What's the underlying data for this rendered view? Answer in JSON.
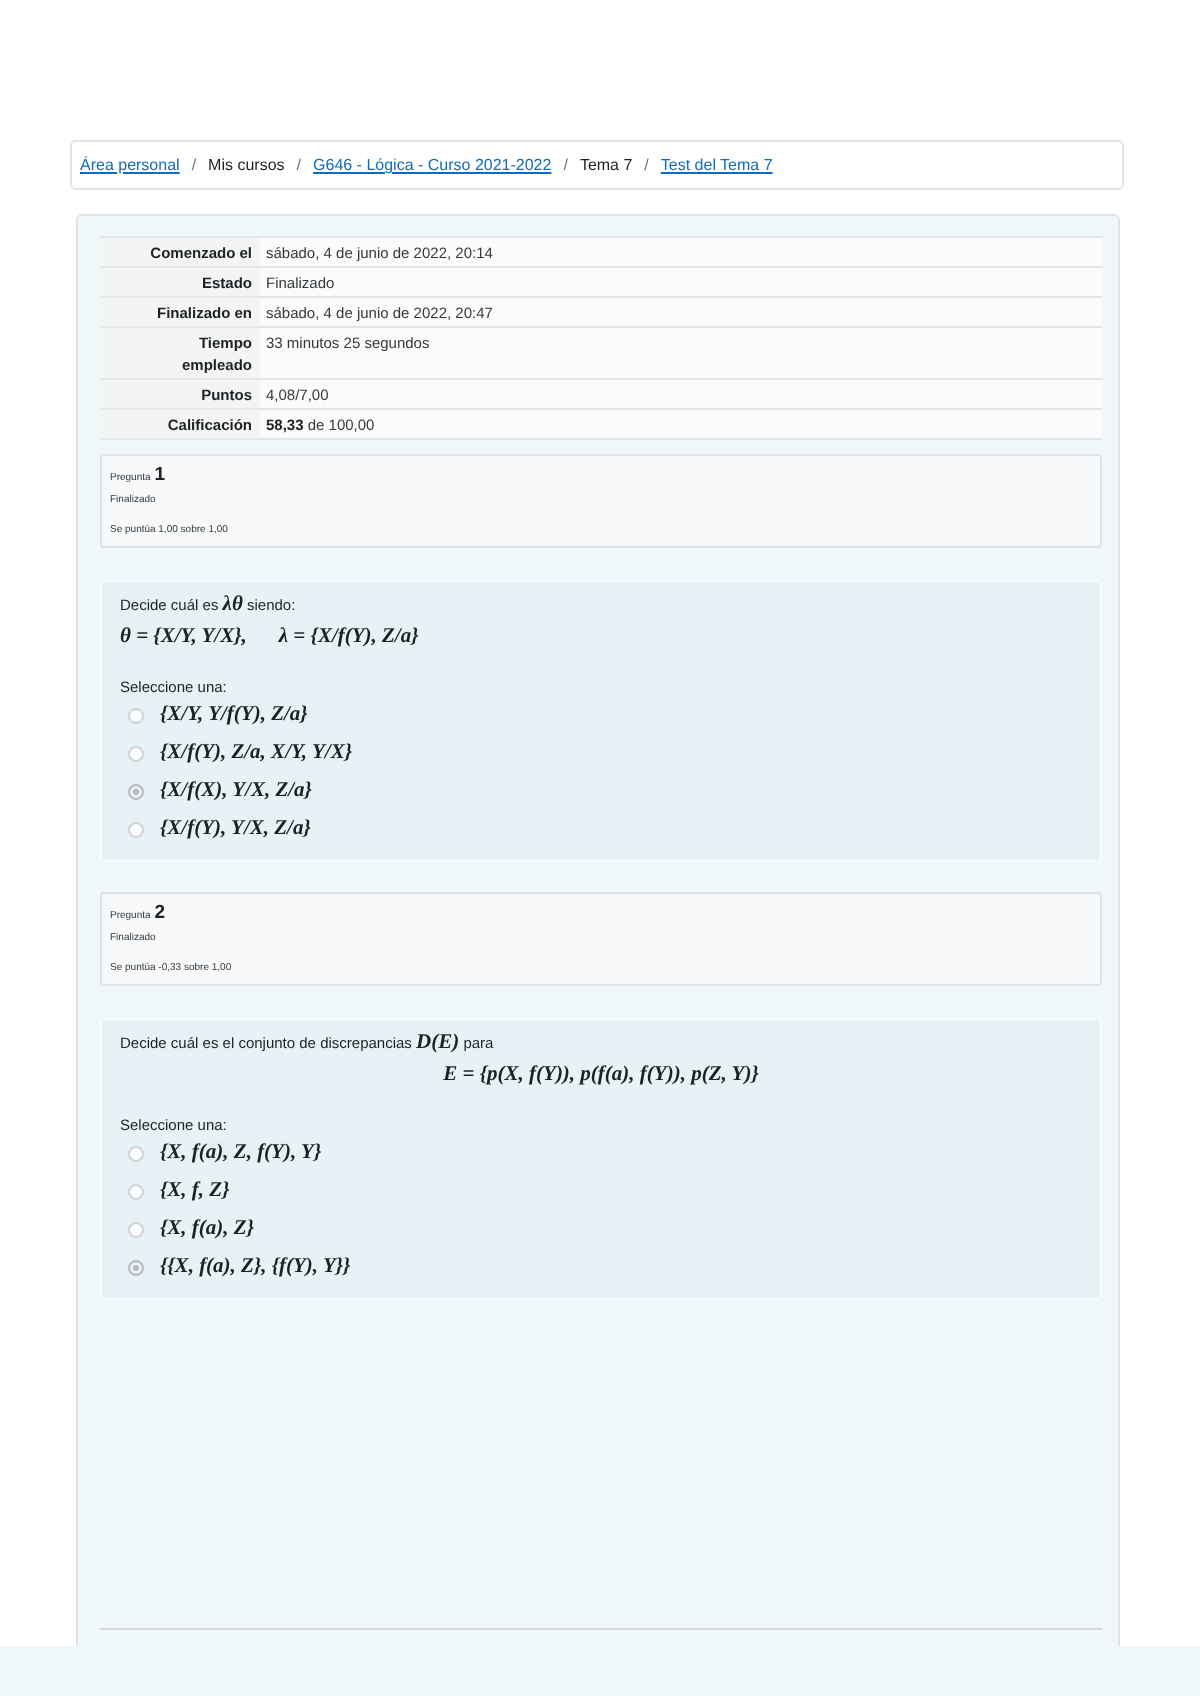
{
  "breadcrumb": {
    "separator": "/",
    "items": [
      {
        "kind": "link",
        "text": "Área personal"
      },
      {
        "kind": "text",
        "text": "Mis cursos"
      },
      {
        "kind": "link",
        "text": "G646 - Lógica - Curso 2021-2022"
      },
      {
        "kind": "text",
        "text": "Tema 7"
      },
      {
        "kind": "link",
        "text": "Test del Tema 7"
      }
    ]
  },
  "summary": [
    {
      "label": "Comenzado el",
      "value": "sábado, 4 de junio de 2022, 20:14"
    },
    {
      "label": "Estado",
      "value": "Finalizado"
    },
    {
      "label": "Finalizado en",
      "value": "sábado, 4 de junio de 2022, 20:47"
    },
    {
      "label": "Tiempo empleado",
      "value": "33 minutos 25 segundos"
    },
    {
      "label": "Puntos",
      "value": "4,08/7,00"
    },
    {
      "label": "Calificación",
      "value": "**58,33** de 100,00"
    }
  ],
  "questions": [
    {
      "label": "Pregunta",
      "number": "1",
      "state": "Finalizado",
      "grade": "Se puntúa 1,00 sobre 1,00",
      "prompt": "Decide cuál es **λθ** siendo:",
      "formula": {
        "kind": "inline",
        "parts": [
          "θ = {X/Y, Y/X},",
          "λ = {X/f(Y), Z/a}"
        ]
      },
      "select_label": "Seleccione una:",
      "options": [
        {
          "text": "{X/Y, Y/f(Y), Z/a}",
          "selected": false
        },
        {
          "text": "{X/f(Y), Z/a, X/Y, Y/X}",
          "selected": false
        },
        {
          "text": "{X/f(X), Y/X, Z/a}",
          "selected": true
        },
        {
          "text": "{X/f(Y), Y/X, Z/a}",
          "selected": false
        }
      ]
    },
    {
      "label": "Pregunta",
      "number": "2",
      "state": "Finalizado",
      "grade": "Se puntúa -0,33 sobre 1,00",
      "prompt": "Decide cuál es el conjunto de discrepancias **D(E)** para",
      "formula": {
        "kind": "display",
        "parts": [
          "E = {p(X, f(Y)), p(f(a), f(Y)), p(Z, Y)}"
        ]
      },
      "select_label": "Seleccione una:",
      "options": [
        {
          "text": "{X, f(a), Z, f(Y), Y}",
          "selected": false
        },
        {
          "text": "{X, f, Z}",
          "selected": false
        },
        {
          "text": "{X, f(a), Z}",
          "selected": false
        },
        {
          "text": "{{X, f(a), Z}, {f(Y), Y}}",
          "selected": true
        }
      ]
    }
  ]
}
